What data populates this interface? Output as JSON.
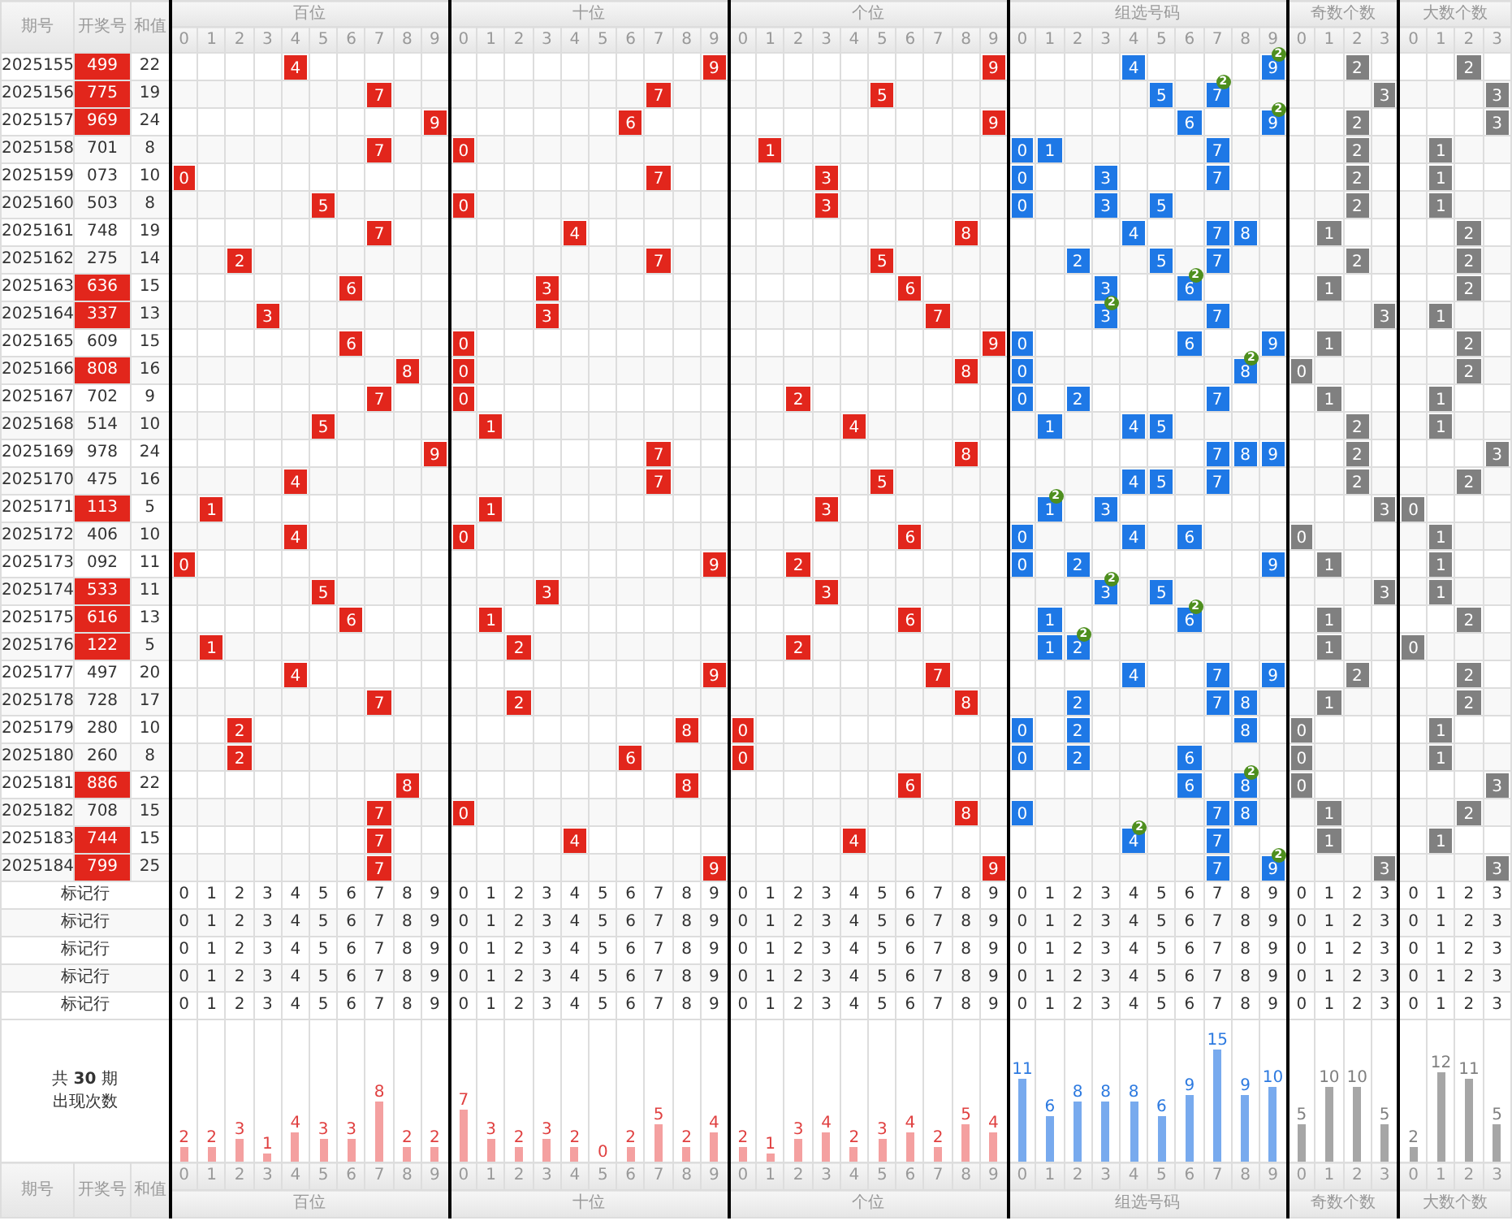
{
  "header": {
    "columns": [
      "期号",
      "开奖号",
      "和值"
    ],
    "sections": [
      {
        "kind": "hundreds",
        "title": "百位",
        "digits": [
          "0",
          "1",
          "2",
          "3",
          "4",
          "5",
          "6",
          "7",
          "8",
          "9"
        ]
      },
      {
        "kind": "tens",
        "title": "十位",
        "digits": [
          "0",
          "1",
          "2",
          "3",
          "4",
          "5",
          "6",
          "7",
          "8",
          "9"
        ]
      },
      {
        "kind": "units",
        "title": "个位",
        "digits": [
          "0",
          "1",
          "2",
          "3",
          "4",
          "5",
          "6",
          "7",
          "8",
          "9"
        ]
      },
      {
        "kind": "group",
        "title": "组选号码",
        "digits": [
          "0",
          "1",
          "2",
          "3",
          "4",
          "5",
          "6",
          "7",
          "8",
          "9"
        ]
      },
      {
        "kind": "odd",
        "title": "奇数个数",
        "digits": [
          "0",
          "1",
          "2",
          "3"
        ]
      },
      {
        "kind": "big",
        "title": "大数个数",
        "digits": [
          "0",
          "1",
          "2",
          "3"
        ]
      }
    ]
  },
  "rows": [
    {
      "period": "2025155",
      "number": "499",
      "highlighted": true,
      "sum": "22",
      "hundreds": "4",
      "tens": "9",
      "units": "9",
      "group": [
        {
          "digit": "4"
        },
        {
          "digit": "9",
          "badge": "2"
        }
      ],
      "odd": "2",
      "big": "2"
    },
    {
      "period": "2025156",
      "number": "775",
      "highlighted": true,
      "sum": "19",
      "hundreds": "7",
      "tens": "7",
      "units": "5",
      "group": [
        {
          "digit": "5"
        },
        {
          "digit": "7",
          "badge": "2"
        }
      ],
      "odd": "3",
      "big": "3"
    },
    {
      "period": "2025157",
      "number": "969",
      "highlighted": true,
      "sum": "24",
      "hundreds": "9",
      "tens": "6",
      "units": "9",
      "group": [
        {
          "digit": "6"
        },
        {
          "digit": "9",
          "badge": "2"
        }
      ],
      "odd": "2",
      "big": "3"
    },
    {
      "period": "2025158",
      "number": "701",
      "highlighted": false,
      "sum": "8",
      "hundreds": "7",
      "tens": "0",
      "units": "1",
      "group": [
        {
          "digit": "0"
        },
        {
          "digit": "1"
        },
        {
          "digit": "7"
        }
      ],
      "odd": "2",
      "big": "1"
    },
    {
      "period": "2025159",
      "number": "073",
      "highlighted": false,
      "sum": "10",
      "hundreds": "0",
      "tens": "7",
      "units": "3",
      "group": [
        {
          "digit": "0"
        },
        {
          "digit": "3"
        },
        {
          "digit": "7"
        }
      ],
      "odd": "2",
      "big": "1"
    },
    {
      "period": "2025160",
      "number": "503",
      "highlighted": false,
      "sum": "8",
      "hundreds": "5",
      "tens": "0",
      "units": "3",
      "group": [
        {
          "digit": "0"
        },
        {
          "digit": "3"
        },
        {
          "digit": "5"
        }
      ],
      "odd": "2",
      "big": "1"
    },
    {
      "period": "2025161",
      "number": "748",
      "highlighted": false,
      "sum": "19",
      "hundreds": "7",
      "tens": "4",
      "units": "8",
      "group": [
        {
          "digit": "4"
        },
        {
          "digit": "7"
        },
        {
          "digit": "8"
        }
      ],
      "odd": "1",
      "big": "2"
    },
    {
      "period": "2025162",
      "number": "275",
      "highlighted": false,
      "sum": "14",
      "hundreds": "2",
      "tens": "7",
      "units": "5",
      "group": [
        {
          "digit": "2"
        },
        {
          "digit": "5"
        },
        {
          "digit": "7"
        }
      ],
      "odd": "2",
      "big": "2"
    },
    {
      "period": "2025163",
      "number": "636",
      "highlighted": true,
      "sum": "15",
      "hundreds": "6",
      "tens": "3",
      "units": "6",
      "group": [
        {
          "digit": "3"
        },
        {
          "digit": "6",
          "badge": "2"
        }
      ],
      "odd": "1",
      "big": "2"
    },
    {
      "period": "2025164",
      "number": "337",
      "highlighted": true,
      "sum": "13",
      "hundreds": "3",
      "tens": "3",
      "units": "7",
      "group": [
        {
          "digit": "3",
          "badge": "2"
        },
        {
          "digit": "7"
        }
      ],
      "odd": "3",
      "big": "1"
    },
    {
      "period": "2025165",
      "number": "609",
      "highlighted": false,
      "sum": "15",
      "hundreds": "6",
      "tens": "0",
      "units": "9",
      "group": [
        {
          "digit": "0"
        },
        {
          "digit": "6"
        },
        {
          "digit": "9"
        }
      ],
      "odd": "1",
      "big": "2"
    },
    {
      "period": "2025166",
      "number": "808",
      "highlighted": true,
      "sum": "16",
      "hundreds": "8",
      "tens": "0",
      "units": "8",
      "group": [
        {
          "digit": "0"
        },
        {
          "digit": "8",
          "badge": "2"
        }
      ],
      "odd": "0",
      "big": "2"
    },
    {
      "period": "2025167",
      "number": "702",
      "highlighted": false,
      "sum": "9",
      "hundreds": "7",
      "tens": "0",
      "units": "2",
      "group": [
        {
          "digit": "0"
        },
        {
          "digit": "2"
        },
        {
          "digit": "7"
        }
      ],
      "odd": "1",
      "big": "1"
    },
    {
      "period": "2025168",
      "number": "514",
      "highlighted": false,
      "sum": "10",
      "hundreds": "5",
      "tens": "1",
      "units": "4",
      "group": [
        {
          "digit": "1"
        },
        {
          "digit": "4"
        },
        {
          "digit": "5"
        }
      ],
      "odd": "2",
      "big": "1"
    },
    {
      "period": "2025169",
      "number": "978",
      "highlighted": false,
      "sum": "24",
      "hundreds": "9",
      "tens": "7",
      "units": "8",
      "group": [
        {
          "digit": "7"
        },
        {
          "digit": "8"
        },
        {
          "digit": "9"
        }
      ],
      "odd": "2",
      "big": "3"
    },
    {
      "period": "2025170",
      "number": "475",
      "highlighted": false,
      "sum": "16",
      "hundreds": "4",
      "tens": "7",
      "units": "5",
      "group": [
        {
          "digit": "4"
        },
        {
          "digit": "5"
        },
        {
          "digit": "7"
        }
      ],
      "odd": "2",
      "big": "2"
    },
    {
      "period": "2025171",
      "number": "113",
      "highlighted": true,
      "sum": "5",
      "hundreds": "1",
      "tens": "1",
      "units": "3",
      "group": [
        {
          "digit": "1",
          "badge": "2"
        },
        {
          "digit": "3"
        }
      ],
      "odd": "3",
      "big": "0"
    },
    {
      "period": "2025172",
      "number": "406",
      "highlighted": false,
      "sum": "10",
      "hundreds": "4",
      "tens": "0",
      "units": "6",
      "group": [
        {
          "digit": "0"
        },
        {
          "digit": "4"
        },
        {
          "digit": "6"
        }
      ],
      "odd": "0",
      "big": "1"
    },
    {
      "period": "2025173",
      "number": "092",
      "highlighted": false,
      "sum": "11",
      "hundreds": "0",
      "tens": "9",
      "units": "2",
      "group": [
        {
          "digit": "0"
        },
        {
          "digit": "2"
        },
        {
          "digit": "9"
        }
      ],
      "odd": "1",
      "big": "1"
    },
    {
      "period": "2025174",
      "number": "533",
      "highlighted": true,
      "sum": "11",
      "hundreds": "5",
      "tens": "3",
      "units": "3",
      "group": [
        {
          "digit": "3",
          "badge": "2"
        },
        {
          "digit": "5"
        }
      ],
      "odd": "3",
      "big": "1"
    },
    {
      "period": "2025175",
      "number": "616",
      "highlighted": true,
      "sum": "13",
      "hundreds": "6",
      "tens": "1",
      "units": "6",
      "group": [
        {
          "digit": "1"
        },
        {
          "digit": "6",
          "badge": "2"
        }
      ],
      "odd": "1",
      "big": "2"
    },
    {
      "period": "2025176",
      "number": "122",
      "highlighted": true,
      "sum": "5",
      "hundreds": "1",
      "tens": "2",
      "units": "2",
      "group": [
        {
          "digit": "1"
        },
        {
          "digit": "2",
          "badge": "2"
        }
      ],
      "odd": "1",
      "big": "0"
    },
    {
      "period": "2025177",
      "number": "497",
      "highlighted": false,
      "sum": "20",
      "hundreds": "4",
      "tens": "9",
      "units": "7",
      "group": [
        {
          "digit": "4"
        },
        {
          "digit": "7"
        },
        {
          "digit": "9"
        }
      ],
      "odd": "2",
      "big": "2"
    },
    {
      "period": "2025178",
      "number": "728",
      "highlighted": false,
      "sum": "17",
      "hundreds": "7",
      "tens": "2",
      "units": "8",
      "group": [
        {
          "digit": "2"
        },
        {
          "digit": "7"
        },
        {
          "digit": "8"
        }
      ],
      "odd": "1",
      "big": "2"
    },
    {
      "period": "2025179",
      "number": "280",
      "highlighted": false,
      "sum": "10",
      "hundreds": "2",
      "tens": "8",
      "units": "0",
      "group": [
        {
          "digit": "0"
        },
        {
          "digit": "2"
        },
        {
          "digit": "8"
        }
      ],
      "odd": "0",
      "big": "1"
    },
    {
      "period": "2025180",
      "number": "260",
      "highlighted": false,
      "sum": "8",
      "hundreds": "2",
      "tens": "6",
      "units": "0",
      "group": [
        {
          "digit": "0"
        },
        {
          "digit": "2"
        },
        {
          "digit": "6"
        }
      ],
      "odd": "0",
      "big": "1"
    },
    {
      "period": "2025181",
      "number": "886",
      "highlighted": true,
      "sum": "22",
      "hundreds": "8",
      "tens": "8",
      "units": "6",
      "group": [
        {
          "digit": "6"
        },
        {
          "digit": "8",
          "badge": "2"
        }
      ],
      "odd": "0",
      "big": "3"
    },
    {
      "period": "2025182",
      "number": "708",
      "highlighted": false,
      "sum": "15",
      "hundreds": "7",
      "tens": "0",
      "units": "8",
      "group": [
        {
          "digit": "0"
        },
        {
          "digit": "7"
        },
        {
          "digit": "8"
        }
      ],
      "odd": "1",
      "big": "2"
    },
    {
      "period": "2025183",
      "number": "744",
      "highlighted": true,
      "sum": "15",
      "hundreds": "7",
      "tens": "4",
      "units": "4",
      "group": [
        {
          "digit": "4",
          "badge": "2"
        },
        {
          "digit": "7"
        }
      ],
      "odd": "1",
      "big": "1"
    },
    {
      "period": "2025184",
      "number": "799",
      "highlighted": true,
      "sum": "25",
      "hundreds": "7",
      "tens": "9",
      "units": "9",
      "group": [
        {
          "digit": "7"
        },
        {
          "digit": "9",
          "badge": "2"
        }
      ],
      "odd": "3",
      "big": "3"
    }
  ],
  "marker_rows": [
    {
      "label": "标记行",
      "cells": [
        [
          "0",
          "1",
          "2",
          "3",
          "4",
          "5",
          "6",
          "7",
          "8",
          "9"
        ],
        [
          "0",
          "1",
          "2",
          "3",
          "4",
          "5",
          "6",
          "7",
          "8",
          "9"
        ],
        [
          "0",
          "1",
          "2",
          "3",
          "4",
          "5",
          "6",
          "7",
          "8",
          "9"
        ],
        [
          "0",
          "1",
          "2",
          "3",
          "4",
          "5",
          "6",
          "7",
          "8",
          "9"
        ],
        [
          "0",
          "1",
          "2",
          "3"
        ],
        [
          "0",
          "1",
          "2",
          "3"
        ]
      ]
    },
    {
      "label": "标记行",
      "cells": [
        [
          "0",
          "1",
          "2",
          "3",
          "4",
          "5",
          "6",
          "7",
          "8",
          "9"
        ],
        [
          "0",
          "1",
          "2",
          "3",
          "4",
          "5",
          "6",
          "7",
          "8",
          "9"
        ],
        [
          "0",
          "1",
          "2",
          "3",
          "4",
          "5",
          "6",
          "7",
          "8",
          "9"
        ],
        [
          "0",
          "1",
          "2",
          "3",
          "4",
          "5",
          "6",
          "7",
          "8",
          "9"
        ],
        [
          "0",
          "1",
          "2",
          "3"
        ],
        [
          "0",
          "1",
          "2",
          "3"
        ]
      ]
    },
    {
      "label": "标记行",
      "cells": [
        [
          "0",
          "1",
          "2",
          "3",
          "4",
          "5",
          "6",
          "7",
          "8",
          "9"
        ],
        [
          "0",
          "1",
          "2",
          "3",
          "4",
          "5",
          "6",
          "7",
          "8",
          "9"
        ],
        [
          "0",
          "1",
          "2",
          "3",
          "4",
          "5",
          "6",
          "7",
          "8",
          "9"
        ],
        [
          "0",
          "1",
          "2",
          "3",
          "4",
          "5",
          "6",
          "7",
          "8",
          "9"
        ],
        [
          "0",
          "1",
          "2",
          "3"
        ],
        [
          "0",
          "1",
          "2",
          "3"
        ]
      ]
    },
    {
      "label": "标记行",
      "cells": [
        [
          "0",
          "1",
          "2",
          "3",
          "4",
          "5",
          "6",
          "7",
          "8",
          "9"
        ],
        [
          "0",
          "1",
          "2",
          "3",
          "4",
          "5",
          "6",
          "7",
          "8",
          "9"
        ],
        [
          "0",
          "1",
          "2",
          "3",
          "4",
          "5",
          "6",
          "7",
          "8",
          "9"
        ],
        [
          "0",
          "1",
          "2",
          "3",
          "4",
          "5",
          "6",
          "7",
          "8",
          "9"
        ],
        [
          "0",
          "1",
          "2",
          "3"
        ],
        [
          "0",
          "1",
          "2",
          "3"
        ]
      ]
    },
    {
      "label": "标记行",
      "cells": [
        [
          "0",
          "1",
          "2",
          "3",
          "4",
          "5",
          "6",
          "7",
          "8",
          "9"
        ],
        [
          "0",
          "1",
          "2",
          "3",
          "4",
          "5",
          "6",
          "7",
          "8",
          "9"
        ],
        [
          "0",
          "1",
          "2",
          "3",
          "4",
          "5",
          "6",
          "7",
          "8",
          "9"
        ],
        [
          "0",
          "1",
          "2",
          "3",
          "4",
          "5",
          "6",
          "7",
          "8",
          "9"
        ],
        [
          "0",
          "1",
          "2",
          "3"
        ],
        [
          "0",
          "1",
          "2",
          "3"
        ]
      ]
    }
  ],
  "stats": {
    "label": [
      "共 **30** 期",
      "出现次数"
    ],
    "counts": [
      [
        "2",
        "2",
        "3",
        "1",
        "4",
        "3",
        "3",
        "8",
        "2",
        "2"
      ],
      [
        "7",
        "3",
        "2",
        "3",
        "2",
        "0",
        "2",
        "5",
        "2",
        "4"
      ],
      [
        "2",
        "1",
        "3",
        "4",
        "2",
        "3",
        "4",
        "2",
        "5",
        "4"
      ],
      [
        "11",
        "6",
        "8",
        "8",
        "8",
        "6",
        "9",
        "15",
        "9",
        "10"
      ],
      [
        "5",
        "10",
        "10",
        "5"
      ],
      [
        "2",
        "12",
        "11",
        "5"
      ]
    ]
  },
  "footer": {
    "columns": [
      "期号",
      "开奖号",
      "和值"
    ],
    "sections": [
      {
        "title": "百位",
        "digits": [
          "0",
          "1",
          "2",
          "3",
          "4",
          "5",
          "6",
          "7",
          "8",
          "9"
        ]
      },
      {
        "title": "十位",
        "digits": [
          "0",
          "1",
          "2",
          "3",
          "4",
          "5",
          "6",
          "7",
          "8",
          "9"
        ]
      },
      {
        "title": "个位",
        "digits": [
          "0",
          "1",
          "2",
          "3",
          "4",
          "5",
          "6",
          "7",
          "8",
          "9"
        ]
      },
      {
        "title": "组选号码",
        "digits": [
          "0",
          "1",
          "2",
          "3",
          "4",
          "5",
          "6",
          "7",
          "8",
          "9"
        ]
      },
      {
        "title": "奇数个数",
        "digits": [
          "0",
          "1",
          "2",
          "3"
        ]
      },
      {
        "title": "大数个数",
        "digits": [
          "0",
          "1",
          "2",
          "3"
        ]
      }
    ]
  }
}
